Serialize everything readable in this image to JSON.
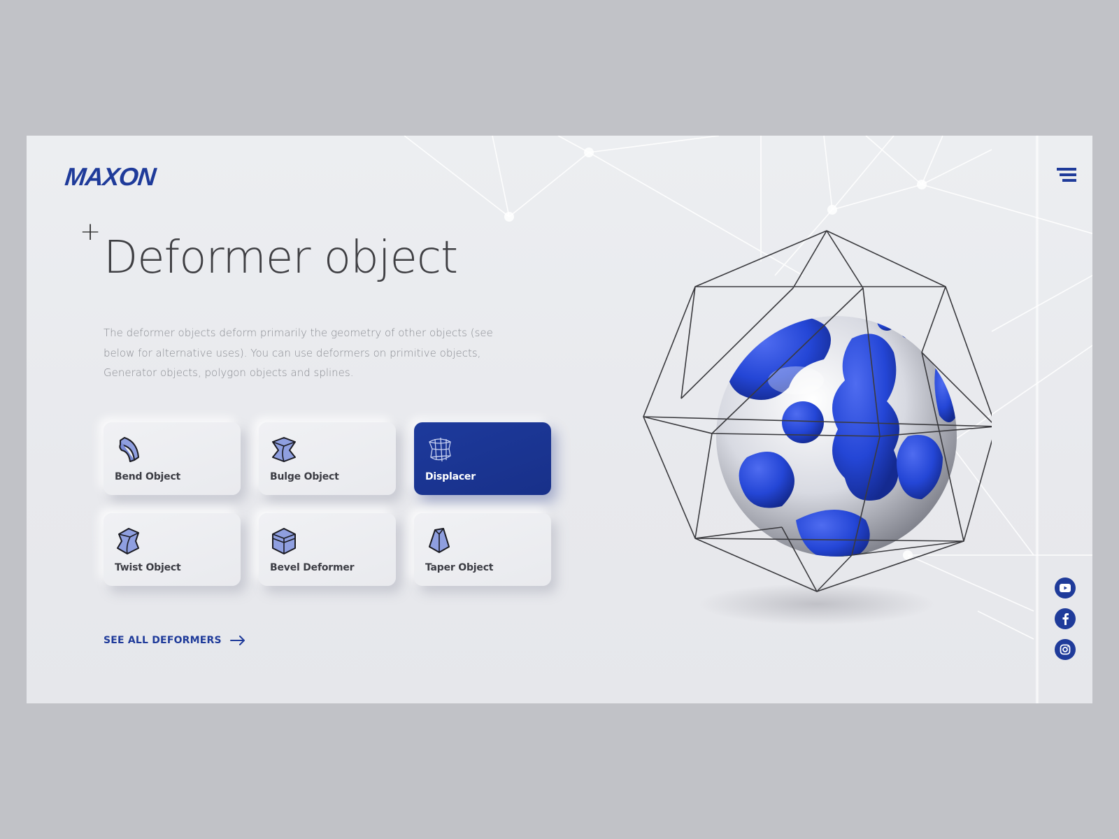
{
  "brand": {
    "logo_text": "MAXON",
    "accent_color": "#1f3b9a"
  },
  "header": {
    "menu_icon": "hamburger-menu-icon"
  },
  "hero": {
    "decoration": "+",
    "title": "Deformer object",
    "description": "The deformer objects deform primarily the geometry of other objects (see below for alternative uses). You can use deformers on primitive objects, Generator objects, polygon objects and splines."
  },
  "deformers": [
    {
      "label": "Bend Object",
      "icon": "bend-object-icon",
      "active": false
    },
    {
      "label": "Bulge Object",
      "icon": "bulge-object-icon",
      "active": false
    },
    {
      "label": "Displacer",
      "icon": "displacer-icon",
      "active": true
    },
    {
      "label": "Twist Object",
      "icon": "twist-object-icon",
      "active": false
    },
    {
      "label": "Bevel Deformer",
      "icon": "bevel-deformer-icon",
      "active": false
    },
    {
      "label": "Taper Object",
      "icon": "taper-object-icon",
      "active": false
    }
  ],
  "cta": {
    "label": "SEE ALL DEFORMERS",
    "icon": "arrow-right-icon"
  },
  "social": [
    {
      "name": "YouTube",
      "icon": "youtube-icon"
    },
    {
      "name": "Facebook",
      "icon": "facebook-icon"
    },
    {
      "name": "Instagram",
      "icon": "instagram-icon"
    }
  ]
}
